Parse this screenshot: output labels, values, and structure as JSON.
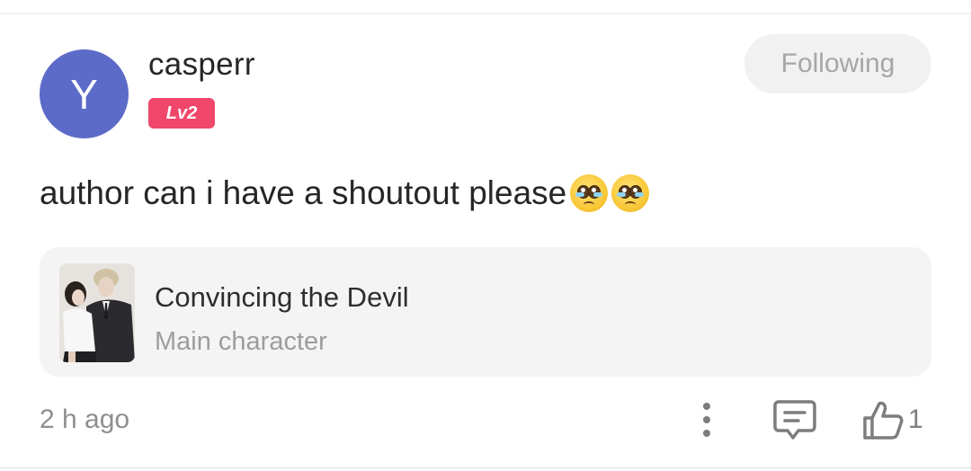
{
  "user": {
    "avatar_letter": "Y",
    "avatar_color": "#5c6bc8",
    "name": "casperr",
    "level": "Lv2",
    "level_color": "#f0476b"
  },
  "follow_button": {
    "label": "Following"
  },
  "comment": {
    "text": "author can i have a shoutout please",
    "emojis": [
      "pleading-face-emoji",
      "pleading-face-emoji"
    ]
  },
  "book": {
    "title": "Convincing the Devil",
    "subtitle": "Main character",
    "cover_icon": "book-cover-illustration"
  },
  "footer": {
    "timestamp": "2 h ago",
    "like_count": "1",
    "icons": {
      "more": "more-vertical-icon",
      "comment": "comment-icon",
      "like": "thumbs-up-icon"
    }
  }
}
